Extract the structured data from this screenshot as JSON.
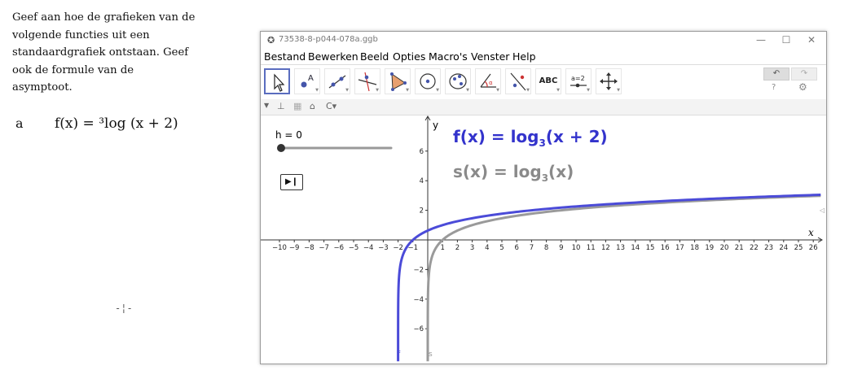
{
  "document": {
    "lines": [
      "Geef aan hoe de grafieken van de",
      "volgende functies uit een",
      "standaardgrafiek ontstaan. Geef",
      "ook de formule van de",
      "asymptoot."
    ],
    "exercise_letter": "a",
    "exercise_formula": "f(x) = ³log (x + 2)",
    "cursor": "-¦-"
  },
  "window": {
    "title": "73538-8-p044-078a.ggb",
    "controls": {
      "minimize": "—",
      "maximize": "☐",
      "close": "✕"
    }
  },
  "menu": [
    "Bestand",
    "Bewerken",
    "Beeld",
    "Opties",
    "Macro's",
    "Venster",
    "Help"
  ],
  "toolbar": {
    "tools": [
      "move-tool",
      "point-tool",
      "line-tool",
      "perpendicular-line-tool",
      "polygon-tool",
      "circle-tool",
      "conic-tool",
      "angle-tool",
      "reflect-tool",
      "text-tool",
      "slider-tool",
      "move-graphics-view-tool"
    ],
    "text_tool_label": "ABC",
    "slider_tool_label": "a=2",
    "undo": "↶",
    "redo": "↷",
    "help": "?",
    "settings": "⚙"
  },
  "graphics": {
    "slider": {
      "label": "h = 0",
      "value": 0
    },
    "play_symbol": "▶❙",
    "label_f": {
      "prefix": "f(x)  =  log",
      "sub": "3",
      "suffix": "(x + 2)"
    },
    "label_s": {
      "prefix": "s(x)  =  log",
      "sub": "3",
      "suffix": "(x)"
    },
    "curve_f_tag": "f",
    "curve_s_tag": "s",
    "x_axis_label": "x",
    "y_axis_label": "y",
    "x_ticks": [
      -10,
      -9,
      -8,
      -7,
      -6,
      -5,
      -4,
      -3,
      -2,
      -1,
      1,
      2,
      3,
      4,
      5,
      6,
      7,
      8,
      9,
      10,
      11,
      12,
      13,
      14,
      15,
      16,
      17,
      18,
      19,
      20,
      21,
      22,
      23,
      24,
      25,
      26
    ],
    "y_ticks": [
      6,
      4,
      2,
      -2,
      -4,
      -6
    ],
    "colors": {
      "f": "#4b4bd8",
      "s": "#9a9a9a",
      "axis": "#333333"
    }
  }
}
